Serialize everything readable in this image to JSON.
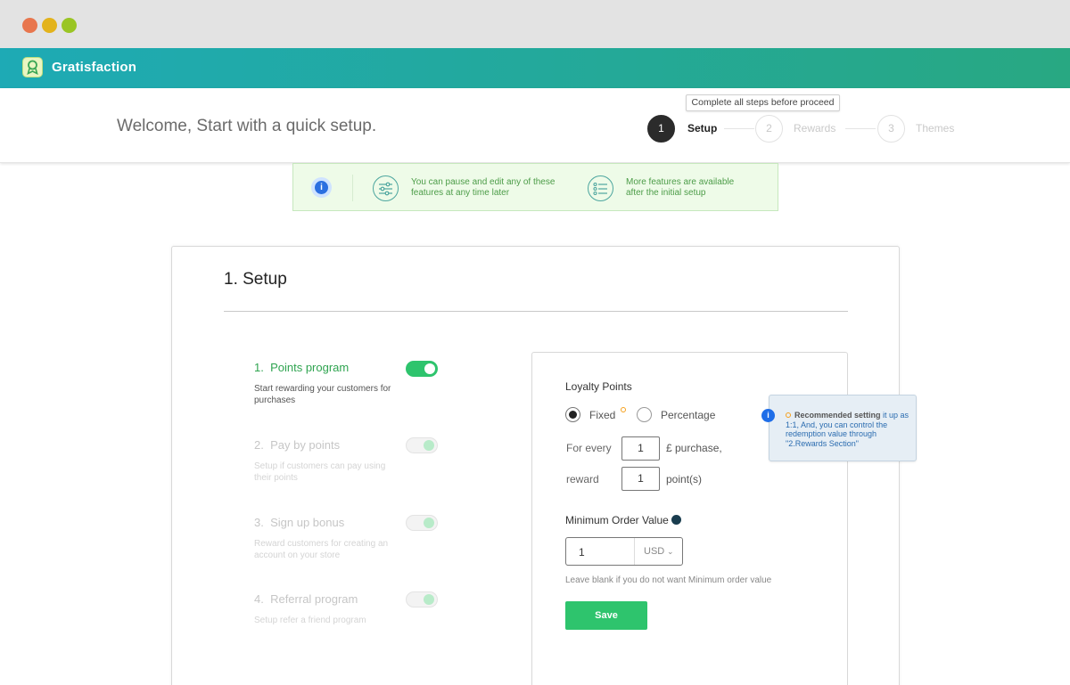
{
  "app": {
    "brand": "Gratisfaction"
  },
  "header": {
    "welcome": "Welcome, Start with a quick setup.",
    "steps_note": "Complete all steps before proceed",
    "steps": [
      {
        "number": "1",
        "label": "Setup",
        "state": "active"
      },
      {
        "number": "2",
        "label": "Rewards",
        "state": "inactive"
      },
      {
        "number": "3",
        "label": "Themes",
        "state": "inactive"
      }
    ]
  },
  "banner": {
    "info_icon": "info-icon",
    "items": [
      {
        "icon": "sliders-icon",
        "line1": "You can pause and edit any of these",
        "line2": "features at any time later"
      },
      {
        "icon": "list-icon",
        "line1": "More features are available",
        "line2": "after the initial setup"
      }
    ]
  },
  "setup": {
    "title": "1. Setup",
    "programs": [
      {
        "number": "1.",
        "title": "Points program",
        "desc": "Start rewarding your customers for purchases",
        "active": true
      },
      {
        "number": "2.",
        "title": "Pay by points",
        "desc": "Setup if customers can pay using their points",
        "active": false
      },
      {
        "number": "3.",
        "title": "Sign up bonus",
        "desc": "Reward customers for creating an account on your store",
        "active": false
      },
      {
        "number": "4.",
        "title": "Referral program",
        "desc": "Setup refer a friend program",
        "active": false
      }
    ]
  },
  "loyalty": {
    "title": "Loyalty Points",
    "options": [
      "Fixed",
      "Percentage"
    ],
    "selected": "Fixed",
    "for_every_label": "For every",
    "for_every_value": "1",
    "purchase_label": "£ purchase,",
    "reward_label": "reward",
    "reward_value": "1",
    "points_label": "point(s)",
    "min_order_label": "Minimum Order Value",
    "min_order_value": "1",
    "currency": "USD",
    "hint": "Leave blank if you do not want Minimum order value",
    "save_label": "Save"
  },
  "tooltip": {
    "heading": "Recommended setting",
    "text": " it up as 1:1, And, you can control the redemption value through \"2.Rewards Section\""
  },
  "colors": {
    "accent_green": "#2ec46d",
    "brand_teal": "#1eaab5",
    "info_blue": "#1f6ee8",
    "banner_bg": "#eefbe8"
  }
}
